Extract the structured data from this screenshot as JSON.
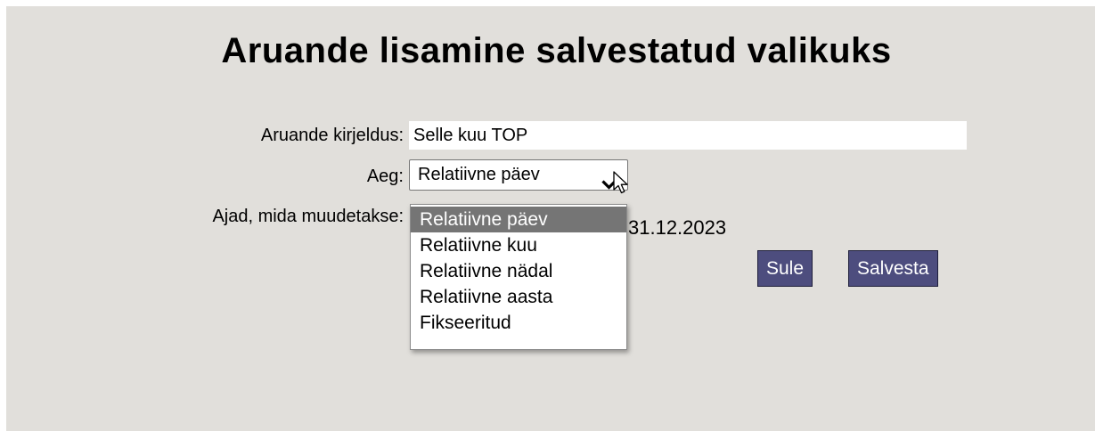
{
  "dialog": {
    "title": "Aruande lisamine salvestatud valikuks",
    "description_label": "Aruande kirjeldus:",
    "description_value": "Selle kuu TOP",
    "time_label": "Aeg:",
    "time_selected": "Relatiivne päev",
    "time_options": [
      "Relatiivne päev",
      "Relatiivne kuu",
      "Relatiivne nädal",
      "Relatiivne aasta",
      "Fikseeritud"
    ],
    "changed_times_label": "Ajad, mida muudetakse:",
    "changed_times_value": "31.12.2023",
    "close_label": "Sule",
    "save_label": "Salvesta"
  },
  "colors": {
    "background": "#e1dfdb",
    "button": "#4d4d7e",
    "selected_option": "#757575"
  }
}
